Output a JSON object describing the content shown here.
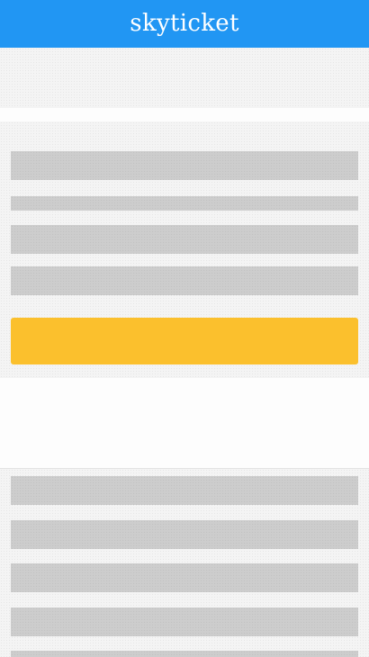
{
  "header": {
    "title": "skyticket",
    "background_color": "#2196f3"
  },
  "search_button": {
    "label": "",
    "color": "#fbc02d"
  },
  "loading_state": {
    "placeholder_color": "#cdcdcd"
  }
}
